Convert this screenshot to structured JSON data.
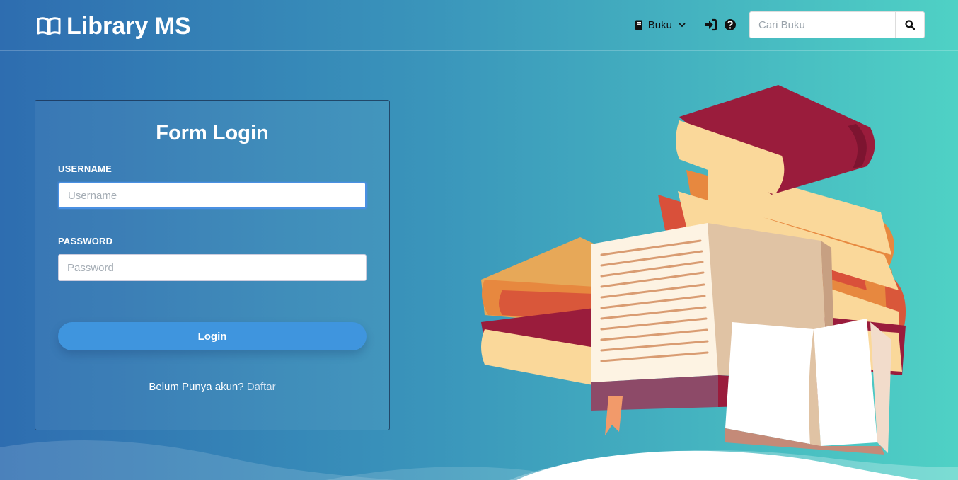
{
  "navbar": {
    "brand": "Library MS",
    "brand_icon": "open-book-icon",
    "dropdown_label": "Buku",
    "dropdown_icon": "book-icon",
    "login_icon": "sign-in-icon",
    "help_icon": "question-circle-icon",
    "search_placeholder": "Cari Buku",
    "search_icon": "search-icon"
  },
  "login": {
    "title": "Form Login",
    "username_label": "USERNAME",
    "username_placeholder": "Username",
    "password_label": "PASSWORD",
    "password_placeholder": "Password",
    "submit_label": "Login",
    "register_prompt": "Belum Punya akun?",
    "register_link": "Daftar"
  },
  "colors": {
    "gradient_start": "#2e6db0",
    "gradient_end": "#4fd1c5",
    "button": "#3f95de"
  }
}
